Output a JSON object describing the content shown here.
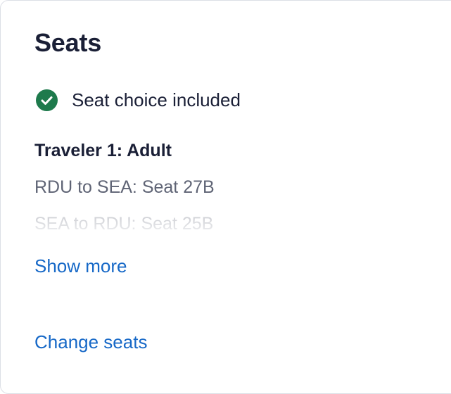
{
  "section": {
    "title": "Seats"
  },
  "status": {
    "icon": "check-circle-icon",
    "icon_color": "#1e7a4c",
    "text": "Seat choice included"
  },
  "traveler": {
    "label": "Traveler 1: Adult",
    "seats": [
      "RDU to SEA: Seat 27B",
      "SEA to RDU: Seat 25B"
    ]
  },
  "actions": {
    "show_more": "Show more",
    "change_seats": "Change seats"
  },
  "colors": {
    "link": "#1668c7",
    "heading": "#1a1f36",
    "secondary_text": "#5f6475"
  }
}
